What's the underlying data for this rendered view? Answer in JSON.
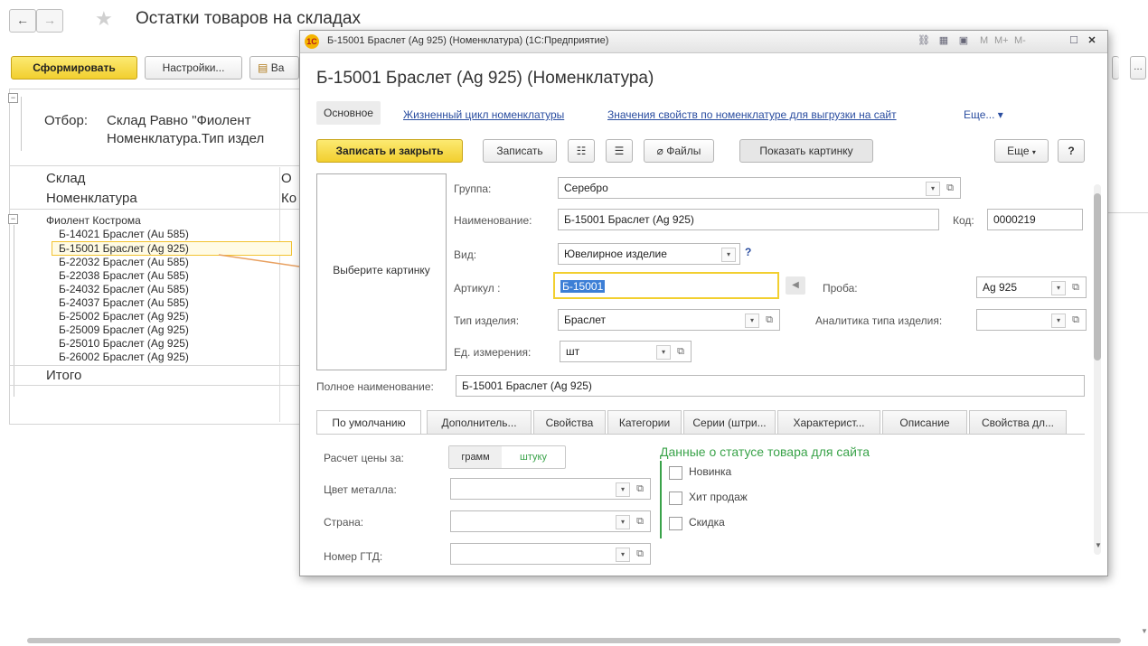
{
  "window": {
    "title": "Остатки товаров на складах",
    "nav_back": "←",
    "nav_forward": "→"
  },
  "toolbar": {
    "generate_label": "Сформировать",
    "settings_label": "Настройки...",
    "variant_label": "Ва"
  },
  "report": {
    "filter_label": "Отбор:",
    "filter_line1": "Склад Равно \"Фиолент",
    "filter_line2": "Номенклатура.Тип издел",
    "col_warehouse": "Склад",
    "col_warehouse_extra": "О",
    "col_nomenclature": "Номенклатура",
    "col_nomenclature_extra": "Ко",
    "group_name": "Фиолент Кострома",
    "rows": [
      "Б-14021 Браслет (Au 585)",
      "Б-15001 Браслет (Ag 925)",
      "Б-22032 Браслет (Au 585)",
      "Б-22038 Браслет (Au 585)",
      "Б-24032 Браслет (Au 585)",
      "Б-24037 Браслет (Au 585)",
      "Б-25002 Браслет (Ag 925)",
      "Б-25009 Браслет (Ag 925)",
      "Б-25010 Браслет (Ag 925)",
      "Б-26002 Браслет (Ag 925)"
    ],
    "total_label": "Итого"
  },
  "dialog": {
    "window_title": "Б-15001 Браслет (Ag 925) (Номенклатура)  (1С:Предприятие)",
    "logo_text": "1С",
    "titlebar_m": "M",
    "titlebar_mplus": "M+",
    "titlebar_mminus": "M-",
    "close_glyph": "✕",
    "heading": "Б-15001 Браслет (Ag 925) (Номенклатура)",
    "tabs": {
      "main": "Основное",
      "lifecycle": "Жизненный цикл номенклатуры",
      "props_site": "Значения свойств по номенклатуре для выгрузки на сайт",
      "more": "Еще... ▾"
    },
    "buttons": {
      "save_close": "Записать и закрыть",
      "save": "Записать",
      "files": "Файлы",
      "show_picture": "Показать картинку",
      "more": "Еще",
      "help": "?"
    },
    "picture_placeholder": "Выберите картинку",
    "fields": {
      "group_label": "Группа:",
      "group_value": "Серебро",
      "name_label": "Наименование:",
      "name_value": "Б-15001 Браслет (Ag 925)",
      "code_label": "Код:",
      "code_value": "0000219",
      "kind_label": "Вид:",
      "kind_value": "Ювелирное изделие",
      "kind_help": "?",
      "article_label": "Артикул :",
      "article_value": "Б-15001",
      "probe_label": "Проба:",
      "probe_value": "Ag 925",
      "item_type_label": "Тип изделия:",
      "item_type_value": "Браслет",
      "analytics_label": "Аналитика типа изделия:",
      "analytics_value": "",
      "unit_label": "Ед. измерения:",
      "unit_value": "шт",
      "fullname_label": "Полное наименование:",
      "fullname_value": "Б-15001 Браслет (Ag 925)"
    },
    "subtabs": [
      "По умолчанию",
      "Дополнитель...",
      "Свойства",
      "Категории",
      "Серии (штри...",
      "Характерист...",
      "Описание",
      "Свойства дл..."
    ],
    "default_tab": {
      "price_label": "Расчет цены за:",
      "price_opt1": "грамм",
      "price_opt2": "штуку",
      "metal_color_label": "Цвет металла:",
      "country_label": "Страна:",
      "gtd_label": "Номер ГТД:",
      "site_status_title": "Данные о статусе товара для сайта",
      "chk_new": "Новинка",
      "chk_hit": "Хит продаж",
      "chk_discount": "Скидка"
    }
  },
  "colors": {
    "accent_yellow": "#f2cf2f",
    "link_blue": "#2a4da0",
    "site_green": "#3aa34a",
    "arrow_orange": "#e8a060"
  }
}
